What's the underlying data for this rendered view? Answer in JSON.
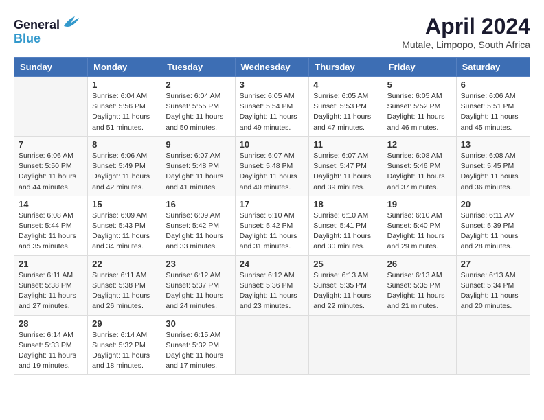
{
  "header": {
    "logo_line1": "General",
    "logo_line2": "Blue",
    "month": "April 2024",
    "location": "Mutale, Limpopo, South Africa"
  },
  "weekdays": [
    "Sunday",
    "Monday",
    "Tuesday",
    "Wednesday",
    "Thursday",
    "Friday",
    "Saturday"
  ],
  "weeks": [
    [
      {
        "day": "",
        "sunrise": "",
        "sunset": "",
        "daylight": ""
      },
      {
        "day": "1",
        "sunrise": "Sunrise: 6:04 AM",
        "sunset": "Sunset: 5:56 PM",
        "daylight": "Daylight: 11 hours and 51 minutes."
      },
      {
        "day": "2",
        "sunrise": "Sunrise: 6:04 AM",
        "sunset": "Sunset: 5:55 PM",
        "daylight": "Daylight: 11 hours and 50 minutes."
      },
      {
        "day": "3",
        "sunrise": "Sunrise: 6:05 AM",
        "sunset": "Sunset: 5:54 PM",
        "daylight": "Daylight: 11 hours and 49 minutes."
      },
      {
        "day": "4",
        "sunrise": "Sunrise: 6:05 AM",
        "sunset": "Sunset: 5:53 PM",
        "daylight": "Daylight: 11 hours and 47 minutes."
      },
      {
        "day": "5",
        "sunrise": "Sunrise: 6:05 AM",
        "sunset": "Sunset: 5:52 PM",
        "daylight": "Daylight: 11 hours and 46 minutes."
      },
      {
        "day": "6",
        "sunrise": "Sunrise: 6:06 AM",
        "sunset": "Sunset: 5:51 PM",
        "daylight": "Daylight: 11 hours and 45 minutes."
      }
    ],
    [
      {
        "day": "7",
        "sunrise": "Sunrise: 6:06 AM",
        "sunset": "Sunset: 5:50 PM",
        "daylight": "Daylight: 11 hours and 44 minutes."
      },
      {
        "day": "8",
        "sunrise": "Sunrise: 6:06 AM",
        "sunset": "Sunset: 5:49 PM",
        "daylight": "Daylight: 11 hours and 42 minutes."
      },
      {
        "day": "9",
        "sunrise": "Sunrise: 6:07 AM",
        "sunset": "Sunset: 5:48 PM",
        "daylight": "Daylight: 11 hours and 41 minutes."
      },
      {
        "day": "10",
        "sunrise": "Sunrise: 6:07 AM",
        "sunset": "Sunset: 5:48 PM",
        "daylight": "Daylight: 11 hours and 40 minutes."
      },
      {
        "day": "11",
        "sunrise": "Sunrise: 6:07 AM",
        "sunset": "Sunset: 5:47 PM",
        "daylight": "Daylight: 11 hours and 39 minutes."
      },
      {
        "day": "12",
        "sunrise": "Sunrise: 6:08 AM",
        "sunset": "Sunset: 5:46 PM",
        "daylight": "Daylight: 11 hours and 37 minutes."
      },
      {
        "day": "13",
        "sunrise": "Sunrise: 6:08 AM",
        "sunset": "Sunset: 5:45 PM",
        "daylight": "Daylight: 11 hours and 36 minutes."
      }
    ],
    [
      {
        "day": "14",
        "sunrise": "Sunrise: 6:08 AM",
        "sunset": "Sunset: 5:44 PM",
        "daylight": "Daylight: 11 hours and 35 minutes."
      },
      {
        "day": "15",
        "sunrise": "Sunrise: 6:09 AM",
        "sunset": "Sunset: 5:43 PM",
        "daylight": "Daylight: 11 hours and 34 minutes."
      },
      {
        "day": "16",
        "sunrise": "Sunrise: 6:09 AM",
        "sunset": "Sunset: 5:42 PM",
        "daylight": "Daylight: 11 hours and 33 minutes."
      },
      {
        "day": "17",
        "sunrise": "Sunrise: 6:10 AM",
        "sunset": "Sunset: 5:42 PM",
        "daylight": "Daylight: 11 hours and 31 minutes."
      },
      {
        "day": "18",
        "sunrise": "Sunrise: 6:10 AM",
        "sunset": "Sunset: 5:41 PM",
        "daylight": "Daylight: 11 hours and 30 minutes."
      },
      {
        "day": "19",
        "sunrise": "Sunrise: 6:10 AM",
        "sunset": "Sunset: 5:40 PM",
        "daylight": "Daylight: 11 hours and 29 minutes."
      },
      {
        "day": "20",
        "sunrise": "Sunrise: 6:11 AM",
        "sunset": "Sunset: 5:39 PM",
        "daylight": "Daylight: 11 hours and 28 minutes."
      }
    ],
    [
      {
        "day": "21",
        "sunrise": "Sunrise: 6:11 AM",
        "sunset": "Sunset: 5:38 PM",
        "daylight": "Daylight: 11 hours and 27 minutes."
      },
      {
        "day": "22",
        "sunrise": "Sunrise: 6:11 AM",
        "sunset": "Sunset: 5:38 PM",
        "daylight": "Daylight: 11 hours and 26 minutes."
      },
      {
        "day": "23",
        "sunrise": "Sunrise: 6:12 AM",
        "sunset": "Sunset: 5:37 PM",
        "daylight": "Daylight: 11 hours and 24 minutes."
      },
      {
        "day": "24",
        "sunrise": "Sunrise: 6:12 AM",
        "sunset": "Sunset: 5:36 PM",
        "daylight": "Daylight: 11 hours and 23 minutes."
      },
      {
        "day": "25",
        "sunrise": "Sunrise: 6:13 AM",
        "sunset": "Sunset: 5:35 PM",
        "daylight": "Daylight: 11 hours and 22 minutes."
      },
      {
        "day": "26",
        "sunrise": "Sunrise: 6:13 AM",
        "sunset": "Sunset: 5:35 PM",
        "daylight": "Daylight: 11 hours and 21 minutes."
      },
      {
        "day": "27",
        "sunrise": "Sunrise: 6:13 AM",
        "sunset": "Sunset: 5:34 PM",
        "daylight": "Daylight: 11 hours and 20 minutes."
      }
    ],
    [
      {
        "day": "28",
        "sunrise": "Sunrise: 6:14 AM",
        "sunset": "Sunset: 5:33 PM",
        "daylight": "Daylight: 11 hours and 19 minutes."
      },
      {
        "day": "29",
        "sunrise": "Sunrise: 6:14 AM",
        "sunset": "Sunset: 5:32 PM",
        "daylight": "Daylight: 11 hours and 18 minutes."
      },
      {
        "day": "30",
        "sunrise": "Sunrise: 6:15 AM",
        "sunset": "Sunset: 5:32 PM",
        "daylight": "Daylight: 11 hours and 17 minutes."
      },
      {
        "day": "",
        "sunrise": "",
        "sunset": "",
        "daylight": ""
      },
      {
        "day": "",
        "sunrise": "",
        "sunset": "",
        "daylight": ""
      },
      {
        "day": "",
        "sunrise": "",
        "sunset": "",
        "daylight": ""
      },
      {
        "day": "",
        "sunrise": "",
        "sunset": "",
        "daylight": ""
      }
    ]
  ]
}
